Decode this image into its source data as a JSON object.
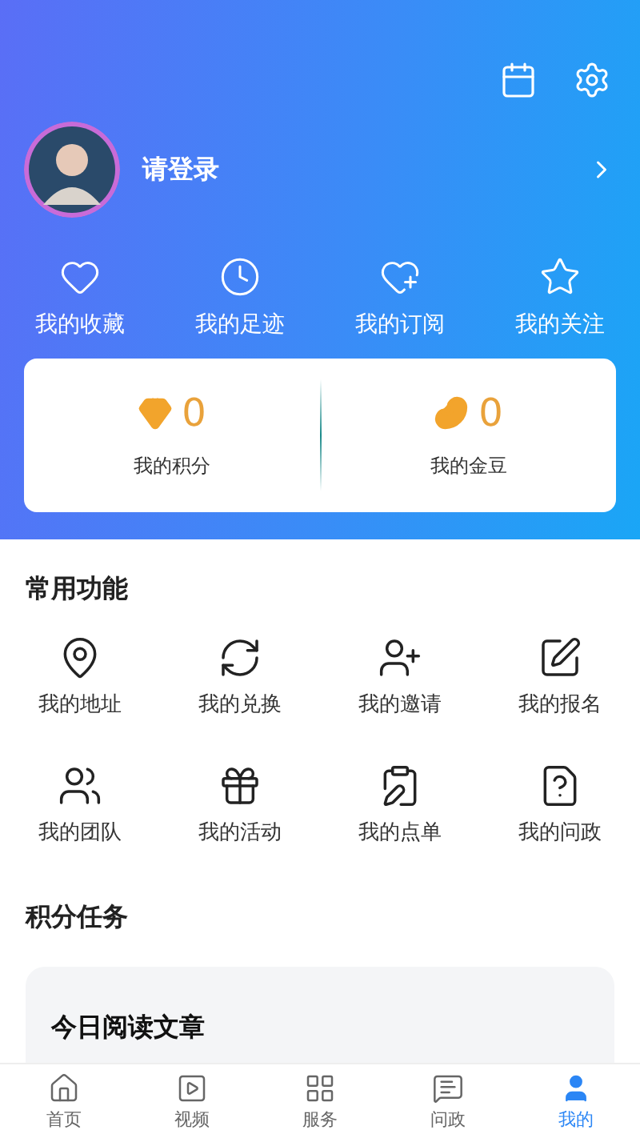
{
  "profile": {
    "login_label": "请登录"
  },
  "shortcuts": [
    {
      "label": "我的收藏"
    },
    {
      "label": "我的足迹"
    },
    {
      "label": "我的订阅"
    },
    {
      "label": "我的关注"
    }
  ],
  "stats": [
    {
      "value": "0",
      "label": "我的积分"
    },
    {
      "value": "0",
      "label": "我的金豆"
    }
  ],
  "functions": {
    "title": "常用功能",
    "items": [
      {
        "label": "我的地址"
      },
      {
        "label": "我的兑换"
      },
      {
        "label": "我的邀请"
      },
      {
        "label": "我的报名"
      },
      {
        "label": "我的团队"
      },
      {
        "label": "我的活动"
      },
      {
        "label": "我的点单"
      },
      {
        "label": "我的问政"
      }
    ]
  },
  "tasks": {
    "title": "积分任务",
    "cards": [
      {
        "title": "今日阅读文章"
      }
    ]
  },
  "tab_bar": [
    {
      "label": "首页",
      "selected": false
    },
    {
      "label": "视频",
      "selected": false
    },
    {
      "label": "服务",
      "selected": false
    },
    {
      "label": "问政",
      "selected": false
    },
    {
      "label": "我的",
      "selected": true
    }
  ]
}
